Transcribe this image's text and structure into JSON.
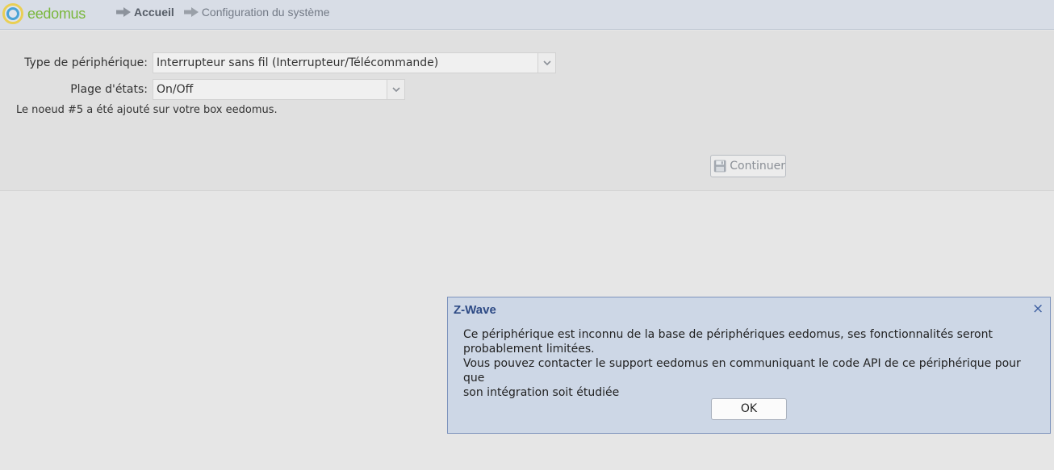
{
  "brand": {
    "name": "eedomus",
    "icon": "eedomus-logo-icon"
  },
  "breadcrumb": {
    "items": [
      {
        "label": "Accueil",
        "icon": "arrow-right-icon"
      },
      {
        "label": "Configuration du système",
        "icon": "arrow-right-icon"
      }
    ]
  },
  "form": {
    "device_type": {
      "label": "Type de périphérique:",
      "value": "Interrupteur sans fil (Interrupteur/Télécommande)"
    },
    "state_range": {
      "label": "Plage d'états:",
      "value": "On/Off"
    },
    "status_message": "Le noeud #5 a été ajouté sur votre box eedomus.",
    "continue_label": "Continuer",
    "continue_icon": "save-disk-icon"
  },
  "dialog": {
    "title": "Z-Wave",
    "close_glyph": "×",
    "line1": "Ce périphérique est inconnu de la base de périphériques eedomus, ses fonctionnalités seront",
    "line2": "probablement limitées.",
    "line3": "Vous pouvez contacter le support eedomus en communiquant le code API de ce périphérique pour que",
    "line4": "son intégration soit étudiée",
    "ok_label": "OK"
  },
  "colors": {
    "header_bg": "#d8dde6",
    "dialog_bg": "#cdd7e6",
    "dialog_title": "#2d4a85",
    "brand_text": "#79b73b"
  }
}
